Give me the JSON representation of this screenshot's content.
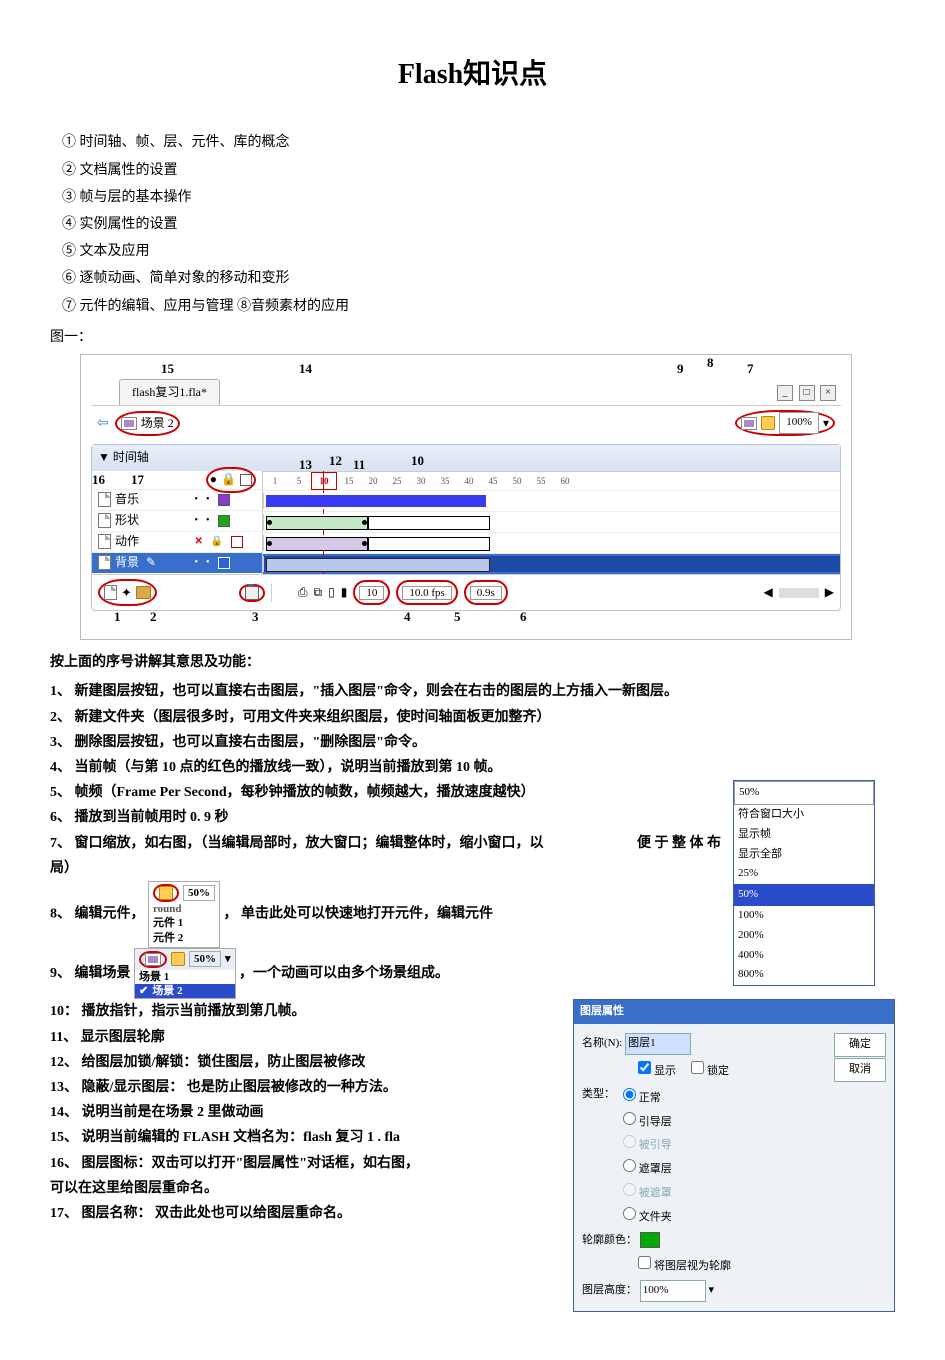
{
  "title": "Flash知识点",
  "intro": [
    "① 时间轴、帧、层、元件、库的概念",
    "② 文档属性的设置",
    "③ 帧与层的基本操作",
    "④ 实例属性的设置",
    "⑤ 文本及应用",
    "⑥ 逐帧动画、简单对象的移动和变形",
    "⑦ 元件的编辑、应用与管理  ⑧音频素材的应用"
  ],
  "fig1_label": "图一：",
  "fig1": {
    "filename": "flash复习1.fla*",
    "scene": "场景 2",
    "timeline_title": "▼ 时间轴",
    "ruler": [
      "1",
      "5",
      "10",
      "15",
      "20",
      "25",
      "30",
      "35",
      "40",
      "45",
      "50",
      "55",
      "60"
    ],
    "layers": [
      {
        "name": "音乐",
        "swatch": "#8a3ad1"
      },
      {
        "name": "形状",
        "swatch": "#1aa81a"
      },
      {
        "name": "动作",
        "swatch": "#a01010",
        "locked": true
      },
      {
        "name": "背景",
        "swatch": "#2a64d8",
        "selected": true
      }
    ],
    "frame_current": "10",
    "fps": "10.0 fps",
    "elapsed": "0.9s",
    "zoom": "100%",
    "top_nums": {
      "n15": "15",
      "n14": "14",
      "n13": "13",
      "n12": "12",
      "n11": "11",
      "n10": "10",
      "n9": "9",
      "n8": "8",
      "n7": "7"
    },
    "left_side": {
      "n16": "16",
      "n17": "17"
    },
    "bot_nums": {
      "n1": "1",
      "n2": "2",
      "n3": "3",
      "n4": "4",
      "n5": "5",
      "n6": "6"
    }
  },
  "explain_header": "按上面的序号讲解其意思及功能：",
  "explain": [
    "1、 新建图层按钮，也可以直接右击图层，\"插入图层\"命令，则会在右击的图层的上方插入一新图层。",
    "2、 新建文件夹（图层很多时，可用文件夹来组织图层，使时间轴面板更加整齐）",
    "3、 删除图层按钮，也可以直接右击图层，\"删除图层\"命令。",
    "4、 当前帧（与第 10 点的红色的播放线一致），说明当前播放到第 10 帧。",
    "5、 帧频（Frame Per Second，每秒钟播放的帧数，帧频越大，播放速度越快）",
    "6、 播放到当前帧用时 0. 9 秒",
    "7、 窗口缩放，如右图，（当编辑局部时，放大窗口；编辑整体时，缩小窗口，以",
    "     局）"
  ],
  "inline_after7": "便 于 整 体 布",
  "zoom_list": {
    "hd": "50%",
    "items": [
      "符合窗口大小",
      "显示帧",
      "显示全部",
      "25%",
      "50%",
      "100%",
      "200%",
      "400%",
      "800%"
    ],
    "selected": "50%"
  },
  "item8_pre": "8、 编辑元件，",
  "item8_ins": {
    "round": "round",
    "s1": "元件 1",
    "s2": "元件 2",
    "zoom": "50%"
  },
  "item8_post": "，  单击此处可以快速地打开元件，编辑元件",
  "item9_pre": "9、 编辑场景",
  "item9_ins": {
    "zoom": "50%",
    "s1": "场景 1",
    "s2": "场景 2"
  },
  "item9_post": "，一个动画可以由多个场景组成。",
  "rest": [
    "10： 播放指针，指示当前播放到第几帧。",
    "11、 显示图层轮廓",
    "12、 给图层加锁/解锁：锁住图层，防止图层被修改",
    "13、 隐蔽/显示图层： 也是防止图层被修改的一种方法。",
    "14、 说明当前是在场景 2 里做动画",
    "15、 说明当前编辑的 FLASH 文档名为：flash 复习 1 . fla",
    "16、 图层图标：双击可以打开\"图层属性\"对话框，如右图，",
    "     可以在这里给图层重命名。",
    "17、 图层名称： 双击此处也可以给图层重命名。"
  ],
  "props": {
    "title": "图层属性",
    "name_lbl": "名称(N):",
    "name_val": "图层1",
    "show": "显示",
    "lock": "锁定",
    "type_lbl": "类型：",
    "types": [
      "正常",
      "引导层",
      "被引导",
      "遮罩层",
      "被遮罩",
      "文件夹"
    ],
    "outline_color": "轮廓颜色：",
    "as_outline": "将图层视为轮廓",
    "height_lbl": "图层高度：",
    "height_val": "100%",
    "ok": "确定",
    "cancel": "取消"
  }
}
